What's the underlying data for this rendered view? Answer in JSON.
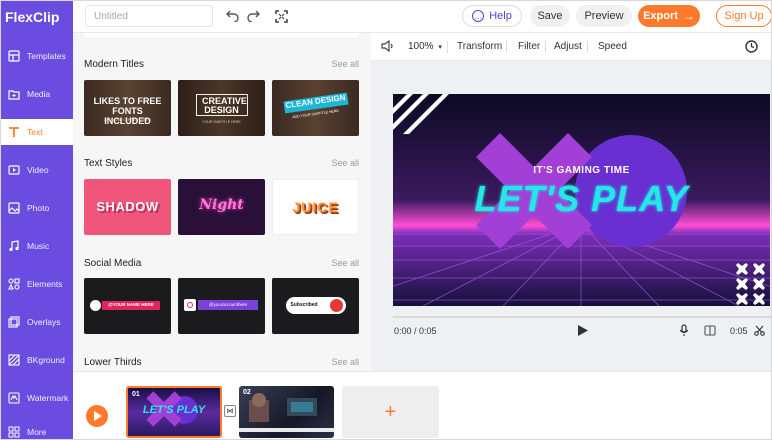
{
  "app": {
    "logo": "FlexClip",
    "title_placeholder": "Untitled"
  },
  "header": {
    "help": "Help",
    "save": "Save",
    "preview": "Preview",
    "export": "Export",
    "signup": "Sign Up"
  },
  "sidebar": {
    "items": [
      {
        "label": "Templates",
        "icon": "templates-icon"
      },
      {
        "label": "Media",
        "icon": "media-icon"
      },
      {
        "label": "Text",
        "icon": "text-icon",
        "active": true
      },
      {
        "label": "Video",
        "icon": "video-icon"
      },
      {
        "label": "Photo",
        "icon": "photo-icon"
      },
      {
        "label": "Music",
        "icon": "music-icon"
      },
      {
        "label": "Elements",
        "icon": "elements-icon"
      },
      {
        "label": "Overlays",
        "icon": "overlays-icon"
      },
      {
        "label": "BKground",
        "icon": "background-icon"
      },
      {
        "label": "Watermark",
        "icon": "watermark-icon"
      },
      {
        "label": "More",
        "icon": "more-icon"
      }
    ]
  },
  "panel": {
    "see_all": "See all",
    "sections": [
      {
        "title": "Modern Titles",
        "thumbs": [
          {
            "text": "LIKES TO FREE FONTS INCLUDED",
            "sub": "ADD YOUR CONTENT HERE"
          },
          {
            "text": "CREATIVE DESIGN",
            "sub": "YOUR SUBTITLE HERE"
          },
          {
            "text": "CLEAN DESIGN",
            "sub": "ADD YOUR SUBTITLE HERE"
          }
        ]
      },
      {
        "title": "Text Styles",
        "thumbs": [
          {
            "text": "SHADOW"
          },
          {
            "text": "Night"
          },
          {
            "text": "JUICE"
          }
        ]
      },
      {
        "title": "Social Media",
        "thumbs": [
          {
            "text": "@YOUR NAME HERE"
          },
          {
            "text": "@youraccounthere"
          },
          {
            "text": "Subscribed"
          }
        ]
      },
      {
        "title": "Lower Thirds",
        "thumbs": []
      }
    ]
  },
  "toolbar": {
    "zoom": "100%",
    "transform": "Transform",
    "filter": "Filter",
    "adjust": "Adjust",
    "speed": "Speed"
  },
  "canvas": {
    "subtitle": "IT'S GAMING TIME",
    "title": "LET'S PLAY"
  },
  "playback": {
    "current": "0:00 / 0:05",
    "duration": "0:05"
  },
  "timeline": {
    "clips": [
      {
        "num": "01",
        "text": "LET'S PLAY"
      },
      {
        "num": "02"
      }
    ],
    "add": "+"
  },
  "colors": {
    "brand": "#6a4ce0",
    "accent": "#ff7a2a"
  }
}
